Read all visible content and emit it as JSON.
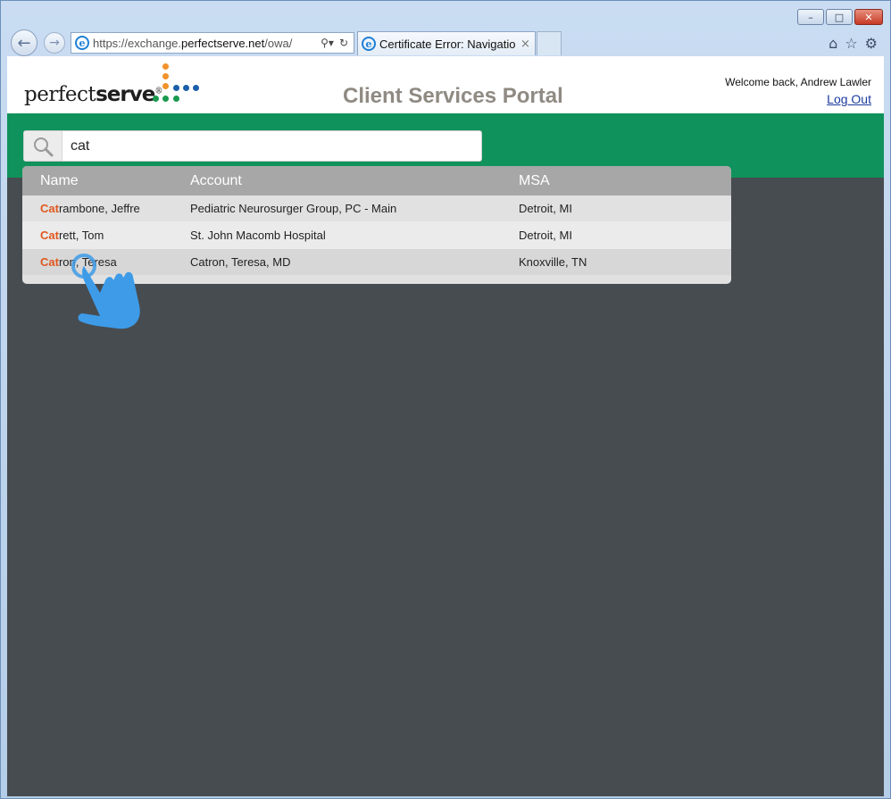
{
  "browser": {
    "url_prefix": "https://exchange.",
    "url_domain": "perfectserve.net",
    "url_suffix": "/owa/",
    "tab_title": "Certificate Error: Navigatio...",
    "tab_close": "×"
  },
  "header": {
    "logo_regular": "perfect",
    "logo_bold": "serve",
    "logo_mark": "®",
    "portal_title": "Client Services Portal",
    "welcome": "Welcome back, Andrew Lawler",
    "logout": "Log Out"
  },
  "search": {
    "value": "cat"
  },
  "results": {
    "columns": [
      "Name",
      "Account",
      "MSA"
    ],
    "rows": [
      {
        "match": "Cat",
        "rest": "rambone, Jeffre",
        "account": "Pediatric Neurosurger Group, PC - Main",
        "msa": "Detroit, MI"
      },
      {
        "match": "Cat",
        "rest": "rett, Tom",
        "account": "St. John Macomb Hospital",
        "msa": "Detroit, MI"
      },
      {
        "match": "Cat",
        "rest": "ron, Teresa",
        "account": "Catron, Teresa, MD",
        "msa": "Knoxville, TN"
      }
    ]
  },
  "colors": {
    "accent_green": "#0f925b",
    "highlight_orange": "#e0581f",
    "page_bg": "#474c51",
    "cursor_blue": "#3d9be8"
  }
}
